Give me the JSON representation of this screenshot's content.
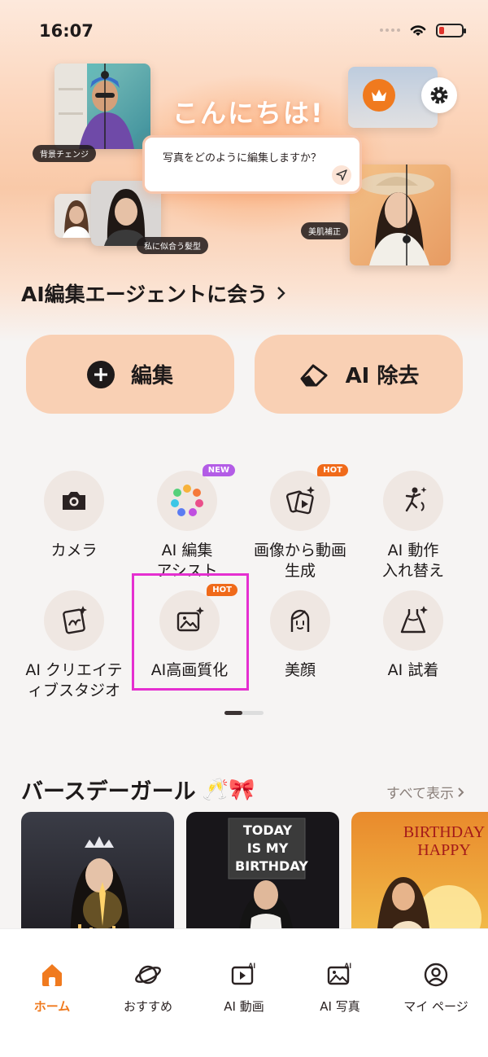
{
  "status_bar": {
    "time": "16:07"
  },
  "hero": {
    "greeting": "こんにちは!",
    "prompt_placeholder": "写真をどのように編集しますか？",
    "tags": {
      "background_change": "背景チェンジ",
      "hairstyle": "私に似合う髪型",
      "skin_retouch": "美肌補正"
    }
  },
  "agent_link": {
    "label": "AI編集エージェントに会う"
  },
  "actions": {
    "edit_label": "編集",
    "remove_label": "AI 除去"
  },
  "features": [
    {
      "label_line1": "カメラ",
      "label_line2": "",
      "icon": "camera-icon",
      "badge": ""
    },
    {
      "label_line1": "AI 編集",
      "label_line2": "アシスト",
      "icon": "flower-palette-icon",
      "badge": "NEW"
    },
    {
      "label_line1": "画像から動画",
      "label_line2": "生成",
      "icon": "image-to-video-icon",
      "badge": "HOT"
    },
    {
      "label_line1": "AI 動作",
      "label_line2": "入れ替え",
      "icon": "pose-swap-icon",
      "badge": ""
    },
    {
      "label_line1": "AI クリエイテ",
      "label_line2": "ィブスタジオ",
      "icon": "creative-studio-icon",
      "badge": ""
    },
    {
      "label_line1": "AI高画質化",
      "label_line2": "",
      "icon": "image-enhance-icon",
      "badge": "HOT"
    },
    {
      "label_line1": "美顔",
      "label_line2": "",
      "icon": "face-beauty-icon",
      "badge": ""
    },
    {
      "label_line1": "AI 試着",
      "label_line2": "",
      "icon": "dress-icon",
      "badge": ""
    }
  ],
  "section": {
    "title": "バースデーガール",
    "emoji": "🥂🎀",
    "see_all": "すべて表示"
  },
  "cards": [
    {
      "caption": ""
    },
    {
      "sign_line1": "TODAY",
      "sign_line2": "IS MY",
      "sign_line3": "BIRTHDAY"
    },
    {
      "text_line1": "BIRTHDAY",
      "text_line2": "HAPPY"
    }
  ],
  "tabbar": {
    "home": "ホーム",
    "recommended": "おすすめ",
    "ai_video": "AI 動画",
    "ai_photo": "AI 写真",
    "my_page": "マイ ページ"
  },
  "colors": {
    "accent": "#f07a1e",
    "highlight": "#e52fd0",
    "button_bg": "#f9d0b4"
  }
}
